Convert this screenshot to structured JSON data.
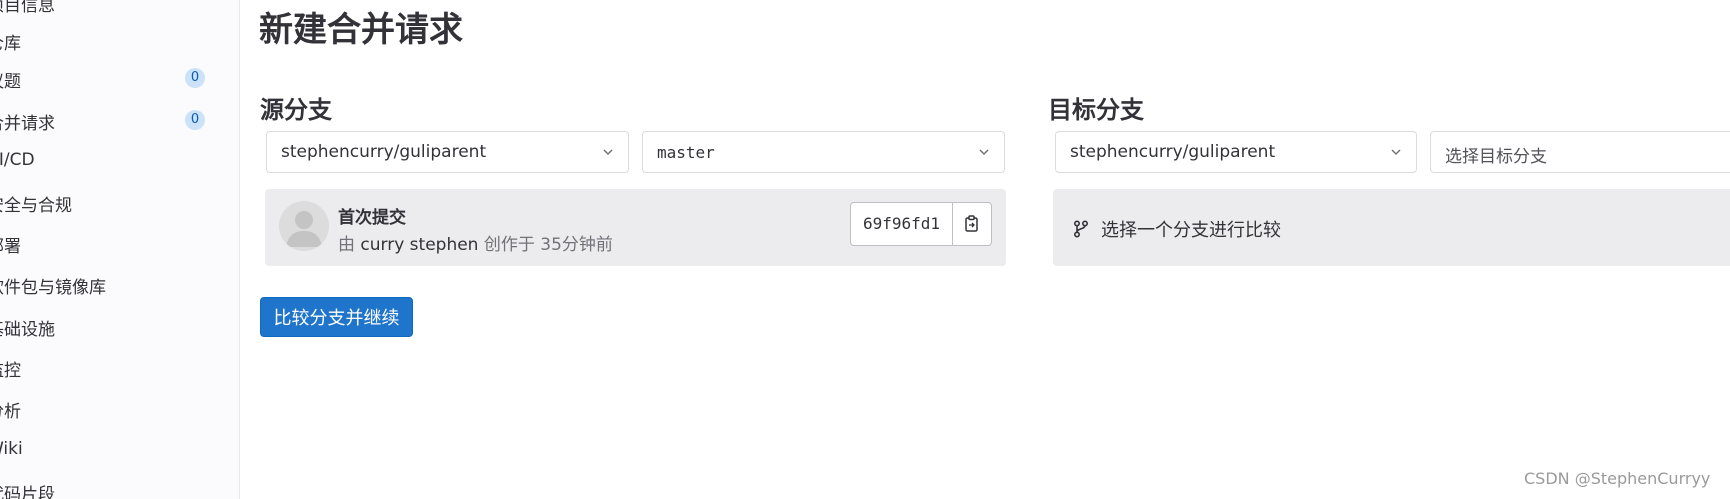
{
  "sidebar": {
    "items": [
      {
        "label": "项目信息",
        "badge": null
      },
      {
        "label": "仓库",
        "badge": null
      },
      {
        "label": "议题",
        "badge": "0"
      },
      {
        "label": "合并请求",
        "badge": "0"
      },
      {
        "label": "CI/CD",
        "badge": null
      },
      {
        "label": "安全与合规",
        "badge": null
      },
      {
        "label": "部署",
        "badge": null
      },
      {
        "label": "软件包与镜像库",
        "badge": null
      },
      {
        "label": "基础设施",
        "badge": null
      },
      {
        "label": "监控",
        "badge": null
      },
      {
        "label": "分析",
        "badge": null
      },
      {
        "label": "Wiki",
        "badge": null
      },
      {
        "label": "代码片段",
        "badge": null
      }
    ]
  },
  "page": {
    "title": "新建合并请求"
  },
  "source": {
    "title": "源分支",
    "project": "stephencurry/guliparent",
    "branch": "master",
    "commit": {
      "title": "首次提交",
      "by": "由",
      "author": "curry stephen",
      "created": "创作于 35分钟前",
      "sha": "69f96fd1"
    }
  },
  "target": {
    "title": "目标分支",
    "project": "stephencurry/guliparent",
    "branch_placeholder": "选择目标分支",
    "hint": "选择一个分支进行比较"
  },
  "actions": {
    "compare_button": "比较分支并继续"
  },
  "watermark": "CSDN @StephenCurryy",
  "colors": {
    "primary": "#1f75cb",
    "panel": "#ececef",
    "badge_bg": "#cbe2f9"
  },
  "icons": [
    "chevron-down-icon",
    "copy-icon",
    "branch-icon",
    "avatar-placeholder"
  ]
}
